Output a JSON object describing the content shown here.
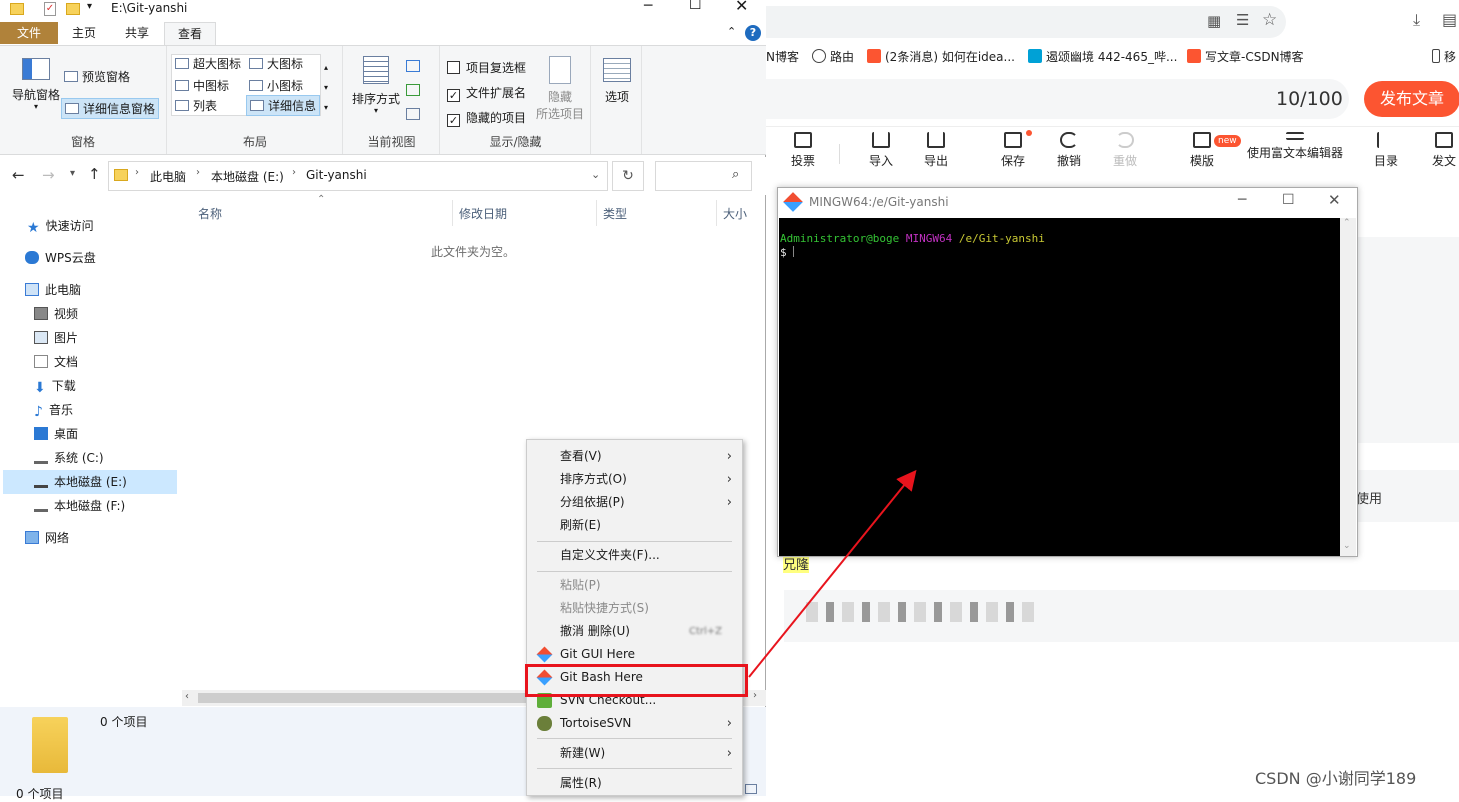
{
  "browser": {
    "bookmarks": [
      "N博客",
      "路由",
      "(2条消息) 如何在idea...",
      "遏颂幽境 442-465_哔...",
      "写文章-CSDN博客",
      "移"
    ],
    "counter": "10/100",
    "publish_label": "发布文章",
    "toolbar": [
      "投票",
      "导入",
      "导出",
      "保存",
      "撤销",
      "重做",
      "模版",
      "使用富文本编辑器",
      "目录",
      "发文"
    ],
    "new_badge": "new",
    "editor_snippets": [
      "使用",
      "兄隆"
    ],
    "accent": "#fc5531"
  },
  "explorer": {
    "title": "E:\\Git-yanshi",
    "tabs": [
      "文件",
      "主页",
      "共享",
      "查看"
    ],
    "ribbon": {
      "pane": {
        "nav": "导航窗格",
        "preview": "预览窗格",
        "details": "详细信息窗格",
        "label": "窗格"
      },
      "layout": {
        "items": [
          "超大图标",
          "大图标",
          "中图标",
          "小图标",
          "列表",
          "详细信息"
        ],
        "label": "布局"
      },
      "current_view": {
        "sort": "排序方式",
        "label": "当前视图"
      },
      "show_hide": {
        "item_checkbox": "项目复选框",
        "file_ext": "文件扩展名",
        "hidden_items": "隐藏的项目",
        "hide": "隐藏",
        "hide_selected": "所选项目",
        "label": "显示/隐藏"
      },
      "options": "选项"
    },
    "path": [
      "此电脑",
      "本地磁盘 (E:)",
      "Git-yanshi"
    ],
    "nav": [
      "快速访问",
      "WPS云盘",
      "此电脑",
      "视频",
      "图片",
      "文档",
      "下载",
      "音乐",
      "桌面",
      "系统 (C:)",
      "本地磁盘 (E:)",
      "本地磁盘 (F:)",
      "网络"
    ],
    "columns": [
      "名称",
      "修改日期",
      "类型",
      "大小"
    ],
    "empty_text": "此文件夹为空。",
    "item_count": "0 个项目",
    "status": "0 个项目"
  },
  "bash": {
    "title": "MINGW64:/e/Git-yanshi",
    "prompt_user": "Administrator@boge",
    "prompt_env": "MINGW64",
    "prompt_path": "/e/Git-yanshi",
    "prompt_symbol": "$"
  },
  "context_menu": {
    "items": [
      "查看(V)",
      "排序方式(O)",
      "分组依据(P)",
      "刷新(E)",
      "自定义文件夹(F)...",
      "粘贴(P)",
      "粘贴快捷方式(S)",
      "撤消 删除(U)",
      "Git GUI Here",
      "Git Bash Here",
      "SVN Checkout...",
      "TortoiseSVN",
      "新建(W)",
      "属性(R)"
    ],
    "undo_shortcut": "Ctrl+Z"
  },
  "watermark": "CSDN @小谢同学189"
}
